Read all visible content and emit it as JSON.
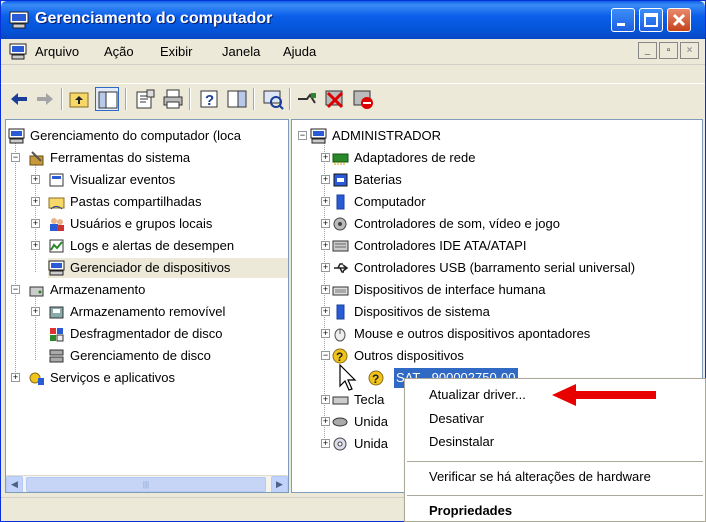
{
  "window": {
    "title": "Gerenciamento do computador"
  },
  "menu": {
    "items": [
      "Arquivo",
      "Ação",
      "Exibir",
      "Janela",
      "Ajuda"
    ]
  },
  "left_tree": {
    "root": "Gerenciamento do computador (loca",
    "tools": "Ferramentas do sistema",
    "tools_children": [
      "Visualizar eventos",
      "Pastas compartilhadas",
      "Usuários e grupos locais",
      "Logs e alertas de desempen",
      "Gerenciador de dispositivos"
    ],
    "storage": "Armazenamento",
    "storage_children": [
      "Armazenamento removível",
      "Desfragmentador de disco",
      "Gerenciamento de disco"
    ],
    "services": "Serviços e aplicativos"
  },
  "right_tree": {
    "root": "ADMINISTRADOR",
    "categories": [
      "Adaptadores de rede",
      "Baterias",
      "Computador",
      "Controladores de som, vídeo e jogo",
      "Controladores IDE ATA/ATAPI",
      "Controladores USB (barramento serial universal)",
      "Dispositivos de interface humana",
      "Dispositivos de sistema",
      "Mouse e outros dispositivos apontadores",
      "Outros dispositivos"
    ],
    "selected_device": "SAT - 900002750-00",
    "after": [
      "Tecla",
      "Unida",
      "Unida"
    ]
  },
  "context_menu": {
    "update": "Atualizar driver...",
    "disable": "Desativar",
    "uninstall": "Desinstalar",
    "scan": "Verificar se há alterações de hardware",
    "properties": "Propriedades"
  },
  "colors": {
    "arrow": "#e80000",
    "selection": "#316ac5"
  }
}
